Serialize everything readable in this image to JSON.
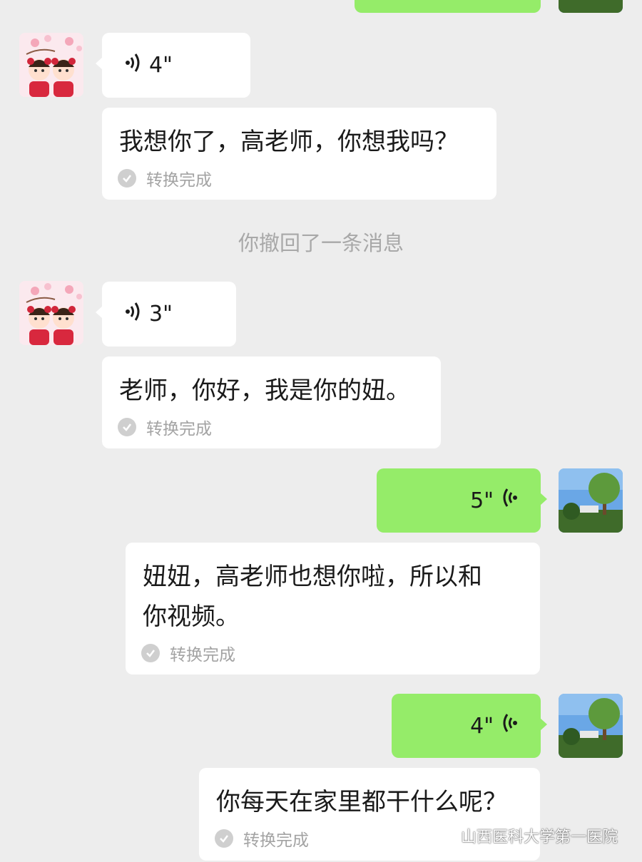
{
  "messages": [
    {
      "voice_duration": "4\"",
      "transcript": "我想你了，高老师，你想我吗？",
      "status": "转换完成"
    },
    {
      "voice_duration": "3\"",
      "transcript": "老师，你好，我是你的妞。",
      "status": "转换完成"
    },
    {
      "voice_duration": "5\"",
      "transcript_line1": "妞妞，高老师也想你啦，所以和",
      "transcript_line2": "你视频。",
      "status": "转换完成"
    },
    {
      "voice_duration": "4\"",
      "transcript": "你每天在家里都干什么呢？",
      "status": "转换完成"
    }
  ],
  "system_notice": "你撤回了一条消息",
  "watermark": "山西医科大学第一医院",
  "colors": {
    "background": "#ededed",
    "incoming_bubble": "#ffffff",
    "outgoing_bubble": "#95ec69"
  },
  "icons": [
    "voice-wave-icon",
    "check-circle-icon",
    "wechat-logo-icon"
  ]
}
